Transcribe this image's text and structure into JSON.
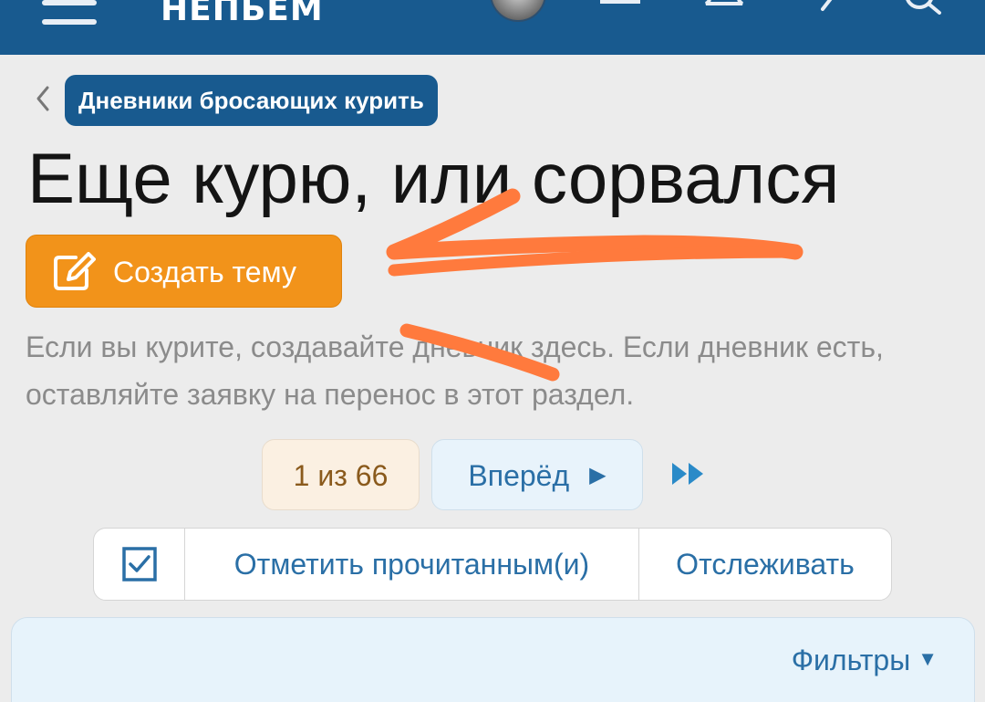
{
  "header": {
    "logo_text": "НЕПЬЕМ",
    "bg_color": "#185a8f"
  },
  "breadcrumb": {
    "label": "Дневники бросающих курить"
  },
  "page": {
    "title": "Еще курю, или сорвался",
    "create_button_label": "Создать тему",
    "description": "Если вы курите, создавайте дневник здесь. Если дневник есть, оставляйте заявку на перенос в этот раздел."
  },
  "pagination": {
    "current": "1 из 66",
    "next_label": "Вперёд"
  },
  "actions": {
    "mark_read_label": "Отметить прочитанным(и)",
    "watch_label": "Отслеживать"
  },
  "filter": {
    "label": "Фильтры"
  },
  "colors": {
    "accent": "#f2931a",
    "link": "#2a6fa6",
    "annotation": "#ff7a3d"
  }
}
